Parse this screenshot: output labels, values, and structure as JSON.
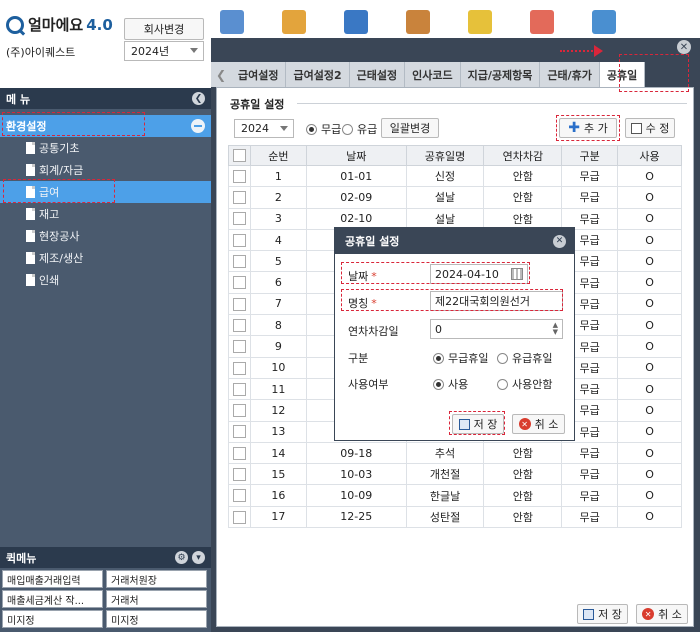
{
  "app": {
    "logo_name": "얼마에요",
    "logo_version": "4.0",
    "company": "(주)아이퀘스트",
    "change_company_label": "회사변경",
    "year_value": "2024년"
  },
  "colors": {
    "accent": "#4da0e8",
    "dark": "#3a4656",
    "annotation": "#d9263a"
  },
  "sidebar": {
    "title": "메 뉴",
    "category": "환경설정",
    "items": [
      {
        "label": "공통기초",
        "icon": "document-icon"
      },
      {
        "label": "회계/자금",
        "icon": "document-icon"
      },
      {
        "label": "급여",
        "icon": "document-icon",
        "active": true
      },
      {
        "label": "재고",
        "icon": "document-icon"
      },
      {
        "label": "현장공사",
        "icon": "document-icon"
      },
      {
        "label": "제조/생산",
        "icon": "document-icon"
      },
      {
        "label": "인쇄",
        "icon": "document-icon"
      }
    ]
  },
  "quickmenu": {
    "title": "퀵메뉴",
    "items": [
      "매입매출거래입력",
      "거래처원장",
      "매출세금계산 작...",
      "거래처",
      "미지정",
      "미지정"
    ]
  },
  "tabs": [
    "급여설정",
    "급여설정2",
    "근태설정",
    "인사코드",
    "지급/공제항목",
    "근태/휴가",
    "공휴일"
  ],
  "holiday": {
    "section_title": "공휴일 설정",
    "year": "2024",
    "radio_paid": "무급",
    "radio_unpaid": "유급",
    "bulk_change": "일괄변경",
    "add": "추 가",
    "edit": "수 정",
    "columns": [
      "순번",
      "날짜",
      "공휴일명",
      "연차차감",
      "구분",
      "사용"
    ],
    "rows": [
      [
        "1",
        "01-01",
        "신정",
        "안함",
        "무급",
        "O"
      ],
      [
        "2",
        "02-09",
        "설날",
        "안함",
        "무급",
        "O"
      ],
      [
        "3",
        "02-10",
        "설날",
        "안함",
        "무급",
        "O"
      ],
      [
        "4",
        "",
        "",
        "",
        "무급",
        "O"
      ],
      [
        "5",
        "",
        "",
        "",
        "무급",
        "O"
      ],
      [
        "6",
        "",
        "",
        "",
        "무급",
        "O"
      ],
      [
        "7",
        "",
        "",
        "",
        "무급",
        "O"
      ],
      [
        "8",
        "",
        "",
        "",
        "무급",
        "O"
      ],
      [
        "9",
        "",
        "",
        "",
        "무급",
        "O"
      ],
      [
        "10",
        "",
        "",
        "",
        "무급",
        "O"
      ],
      [
        "11",
        "",
        "",
        "",
        "무급",
        "O"
      ],
      [
        "12",
        "",
        "",
        "",
        "무급",
        "O"
      ],
      [
        "13",
        "",
        "",
        "",
        "무급",
        "O"
      ],
      [
        "14",
        "09-18",
        "추석",
        "안함",
        "무급",
        "O"
      ],
      [
        "15",
        "10-03",
        "개천절",
        "안함",
        "무급",
        "O"
      ],
      [
        "16",
        "10-09",
        "한글날",
        "안함",
        "무급",
        "O"
      ],
      [
        "17",
        "12-25",
        "성탄절",
        "안함",
        "무급",
        "O"
      ]
    ],
    "save": "저 장",
    "cancel": "취 소"
  },
  "dialog": {
    "title": "공휴일 설정",
    "date_label": "날짜",
    "date_value": "2024-04-10",
    "name_label": "명칭",
    "name_value": "제22대국회의원선거",
    "deduct_label": "연차차감일",
    "deduct_value": "0",
    "type_label": "구분",
    "type_opt1": "무급휴일",
    "type_opt2": "유급휴일",
    "use_label": "사용여부",
    "use_opt1": "사용",
    "use_opt2": "사용안함",
    "save": "저 장",
    "cancel": "취 소",
    "required_mark": "*"
  }
}
